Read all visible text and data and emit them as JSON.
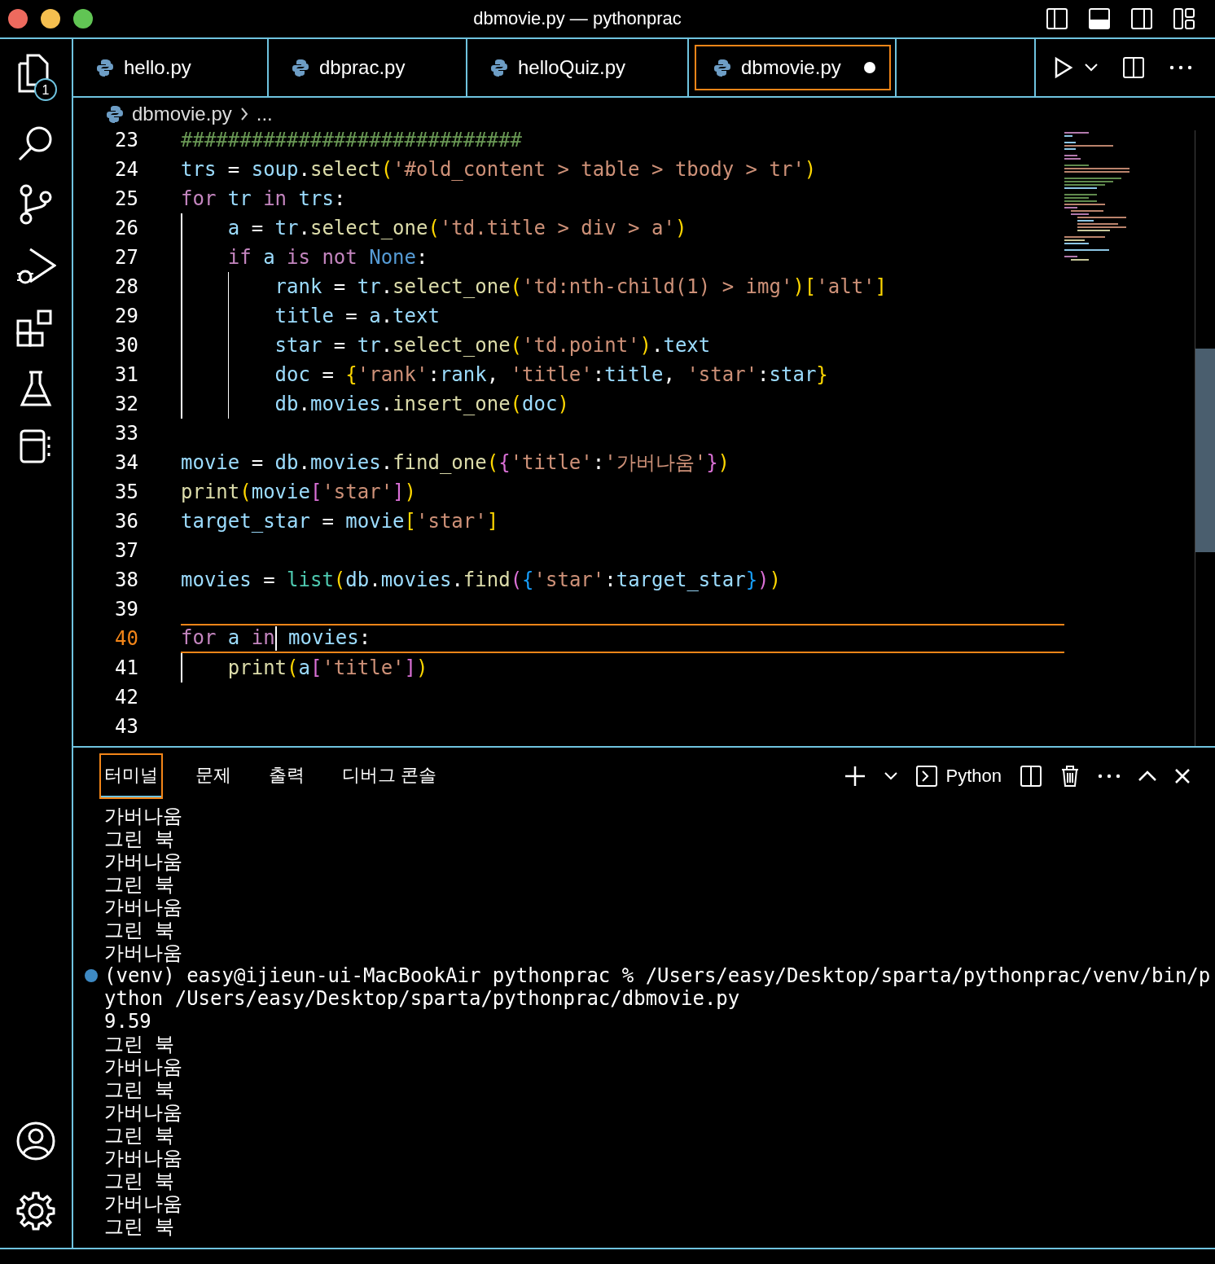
{
  "window": {
    "title": "dbmovie.py — pythonprac"
  },
  "activity_bar": {
    "items": [
      {
        "kind": "files",
        "badge": "1"
      },
      {
        "kind": "search"
      },
      {
        "kind": "source-control"
      },
      {
        "kind": "run-debug"
      },
      {
        "kind": "extensions"
      },
      {
        "kind": "flask"
      },
      {
        "kind": "notebook"
      }
    ],
    "bottom": [
      {
        "kind": "account"
      },
      {
        "kind": "settings"
      }
    ]
  },
  "tabs": [
    {
      "label": "hello.py",
      "selected": false,
      "modified": false
    },
    {
      "label": "dbprac.py",
      "selected": false,
      "modified": false
    },
    {
      "label": "helloQuiz.py",
      "selected": false,
      "modified": false
    },
    {
      "label": "dbmovie.py",
      "selected": true,
      "modified": true
    }
  ],
  "breadcrumb": [
    "dbmovie.py",
    "..."
  ],
  "editor": {
    "lines": [
      {
        "number": "23",
        "current": false,
        "tokens": [
          {
            "kind": "com",
            "text": "#############################"
          }
        ]
      },
      {
        "number": "24",
        "current": false,
        "tokens": [
          {
            "kind": "var",
            "text": "trs"
          },
          {
            "kind": "op",
            "text": " = "
          },
          {
            "kind": "var",
            "text": "soup"
          },
          {
            "kind": "op",
            "text": "."
          },
          {
            "kind": "fn",
            "text": "select"
          },
          {
            "kind": "b1",
            "text": "("
          },
          {
            "kind": "str",
            "text": "'#old_content > table > tbody > tr'"
          },
          {
            "kind": "b1",
            "text": ")"
          }
        ]
      },
      {
        "number": "25",
        "current": false,
        "tokens": [
          {
            "kind": "kw",
            "text": "for "
          },
          {
            "kind": "var",
            "text": "tr "
          },
          {
            "kind": "kw",
            "text": "in "
          },
          {
            "kind": "var",
            "text": "trs"
          },
          {
            "kind": "op",
            "text": ":"
          }
        ]
      },
      {
        "number": "26",
        "current": false,
        "tokens": [
          {
            "kind": "var",
            "text": "    a"
          },
          {
            "kind": "op",
            "text": " = "
          },
          {
            "kind": "var",
            "text": "tr"
          },
          {
            "kind": "op",
            "text": "."
          },
          {
            "kind": "fn",
            "text": "select_one"
          },
          {
            "kind": "b1",
            "text": "("
          },
          {
            "kind": "str",
            "text": "'td.title > div > a'"
          },
          {
            "kind": "b1",
            "text": ")"
          }
        ]
      },
      {
        "number": "27",
        "current": false,
        "tokens": [
          {
            "kind": "kw",
            "text": "    if "
          },
          {
            "kind": "var",
            "text": "a "
          },
          {
            "kind": "kw",
            "text": "is not "
          },
          {
            "kind": "const",
            "text": "None"
          },
          {
            "kind": "op",
            "text": ":"
          }
        ]
      },
      {
        "number": "28",
        "current": false,
        "tokens": [
          {
            "kind": "var",
            "text": "        rank"
          },
          {
            "kind": "op",
            "text": " = "
          },
          {
            "kind": "var",
            "text": "tr"
          },
          {
            "kind": "op",
            "text": "."
          },
          {
            "kind": "fn",
            "text": "select_one"
          },
          {
            "kind": "b1",
            "text": "("
          },
          {
            "kind": "str",
            "text": "'td:nth-child(1) > img'"
          },
          {
            "kind": "b1",
            "text": ")["
          },
          {
            "kind": "str",
            "text": "'alt'"
          },
          {
            "kind": "b1",
            "text": "]"
          }
        ]
      },
      {
        "number": "29",
        "current": false,
        "tokens": [
          {
            "kind": "var",
            "text": "        title"
          },
          {
            "kind": "op",
            "text": " = "
          },
          {
            "kind": "var",
            "text": "a"
          },
          {
            "kind": "op",
            "text": "."
          },
          {
            "kind": "var",
            "text": "text"
          }
        ]
      },
      {
        "number": "30",
        "current": false,
        "tokens": [
          {
            "kind": "var",
            "text": "        star"
          },
          {
            "kind": "op",
            "text": " = "
          },
          {
            "kind": "var",
            "text": "tr"
          },
          {
            "kind": "op",
            "text": "."
          },
          {
            "kind": "fn",
            "text": "select_one"
          },
          {
            "kind": "b1",
            "text": "("
          },
          {
            "kind": "str",
            "text": "'td.point'"
          },
          {
            "kind": "b1",
            "text": ")"
          },
          {
            "kind": "op",
            "text": "."
          },
          {
            "kind": "var",
            "text": "text"
          }
        ]
      },
      {
        "number": "31",
        "current": false,
        "tokens": [
          {
            "kind": "var",
            "text": "        doc"
          },
          {
            "kind": "op",
            "text": " = "
          },
          {
            "kind": "b1",
            "text": "{"
          },
          {
            "kind": "str",
            "text": "'rank'"
          },
          {
            "kind": "op",
            "text": ":"
          },
          {
            "kind": "var",
            "text": "rank"
          },
          {
            "kind": "op",
            "text": ", "
          },
          {
            "kind": "str",
            "text": "'title'"
          },
          {
            "kind": "op",
            "text": ":"
          },
          {
            "kind": "var",
            "text": "title"
          },
          {
            "kind": "op",
            "text": ", "
          },
          {
            "kind": "str",
            "text": "'star'"
          },
          {
            "kind": "op",
            "text": ":"
          },
          {
            "kind": "var",
            "text": "star"
          },
          {
            "kind": "b1",
            "text": "}"
          }
        ]
      },
      {
        "number": "32",
        "current": false,
        "tokens": [
          {
            "kind": "var",
            "text": "        db"
          },
          {
            "kind": "op",
            "text": "."
          },
          {
            "kind": "var",
            "text": "movies"
          },
          {
            "kind": "op",
            "text": "."
          },
          {
            "kind": "fn",
            "text": "insert_one"
          },
          {
            "kind": "b1",
            "text": "("
          },
          {
            "kind": "var",
            "text": "doc"
          },
          {
            "kind": "b1",
            "text": ")"
          }
        ]
      },
      {
        "number": "33",
        "current": false
      },
      {
        "number": "34",
        "current": false,
        "tokens": [
          {
            "kind": "var",
            "text": "movie"
          },
          {
            "kind": "op",
            "text": " = "
          },
          {
            "kind": "var",
            "text": "db"
          },
          {
            "kind": "op",
            "text": "."
          },
          {
            "kind": "var",
            "text": "movies"
          },
          {
            "kind": "op",
            "text": "."
          },
          {
            "kind": "fn",
            "text": "find_one"
          },
          {
            "kind": "b1",
            "text": "("
          },
          {
            "kind": "b2",
            "text": "{"
          },
          {
            "kind": "str",
            "text": "'title'"
          },
          {
            "kind": "op",
            "text": ":"
          },
          {
            "kind": "str",
            "text": "'가버나움'"
          },
          {
            "kind": "b2",
            "text": "}"
          },
          {
            "kind": "b1",
            "text": ")"
          }
        ]
      },
      {
        "number": "35",
        "current": false,
        "tokens": [
          {
            "kind": "fn",
            "text": "print"
          },
          {
            "kind": "b1",
            "text": "("
          },
          {
            "kind": "var",
            "text": "movie"
          },
          {
            "kind": "b2",
            "text": "["
          },
          {
            "kind": "str",
            "text": "'star'"
          },
          {
            "kind": "b2",
            "text": "]"
          },
          {
            "kind": "b1",
            "text": ")"
          }
        ]
      },
      {
        "number": "36",
        "current": false,
        "tokens": [
          {
            "kind": "var",
            "text": "target_star"
          },
          {
            "kind": "op",
            "text": " = "
          },
          {
            "kind": "var",
            "text": "movie"
          },
          {
            "kind": "b1",
            "text": "["
          },
          {
            "kind": "str",
            "text": "'star'"
          },
          {
            "kind": "b1",
            "text": "]"
          }
        ]
      },
      {
        "number": "37",
        "current": false
      },
      {
        "number": "38",
        "current": false,
        "tokens": [
          {
            "kind": "var",
            "text": "movies"
          },
          {
            "kind": "op",
            "text": " = "
          },
          {
            "kind": "cls",
            "text": "list"
          },
          {
            "kind": "b1",
            "text": "("
          },
          {
            "kind": "var",
            "text": "db"
          },
          {
            "kind": "op",
            "text": "."
          },
          {
            "kind": "var",
            "text": "movies"
          },
          {
            "kind": "op",
            "text": "."
          },
          {
            "kind": "fn",
            "text": "find"
          },
          {
            "kind": "b2",
            "text": "("
          },
          {
            "kind": "b3",
            "text": "{"
          },
          {
            "kind": "str",
            "text": "'star'"
          },
          {
            "kind": "op",
            "text": ":"
          },
          {
            "kind": "var",
            "text": "target_star"
          },
          {
            "kind": "b3",
            "text": "}"
          },
          {
            "kind": "b2",
            "text": ")"
          },
          {
            "kind": "b1",
            "text": ")"
          }
        ]
      },
      {
        "number": "39",
        "current": false
      },
      {
        "number": "40",
        "current": true,
        "tokens": [
          {
            "kind": "kw",
            "text": "for "
          },
          {
            "kind": "var",
            "text": "a "
          },
          {
            "kind": "kw",
            "text": "in"
          },
          {
            "kind": "caret"
          },
          {
            "kind": "var",
            "text": " movies"
          },
          {
            "kind": "op",
            "text": ":"
          }
        ]
      },
      {
        "number": "41",
        "current": false,
        "tokens": [
          {
            "kind": "fn",
            "text": "    print"
          },
          {
            "kind": "b1",
            "text": "("
          },
          {
            "kind": "var",
            "text": "a"
          },
          {
            "kind": "b2",
            "text": "["
          },
          {
            "kind": "str",
            "text": "'title'"
          },
          {
            "kind": "b2",
            "text": "]"
          },
          {
            "kind": "b1",
            "text": ")"
          }
        ]
      },
      {
        "number": "42",
        "current": false
      },
      {
        "number": "43",
        "current": false
      }
    ]
  },
  "panel": {
    "tabs": [
      {
        "label": "터미널",
        "selected": true
      },
      {
        "label": "문제",
        "selected": false
      },
      {
        "label": "출력",
        "selected": false
      },
      {
        "label": "디버그 콘솔",
        "selected": false
      }
    ],
    "terminal_profile": "Python",
    "terminal": [
      {
        "kind": "output",
        "text": "가버나움"
      },
      {
        "kind": "output",
        "text": "그린 북"
      },
      {
        "kind": "output",
        "text": "가버나움"
      },
      {
        "kind": "output",
        "text": "그린 북"
      },
      {
        "kind": "output",
        "text": "가버나움"
      },
      {
        "kind": "output",
        "text": "그린 북"
      },
      {
        "kind": "output",
        "text": "가버나움"
      },
      {
        "kind": "prompt",
        "text": "(venv) easy@ijieun-ui-MacBookAir pythonprac % /Users/easy/Desktop/sparta/pythonprac/venv/bin/p"
      },
      {
        "kind": "output",
        "text": "ython /Users/easy/Desktop/sparta/pythonprac/dbmovie.py"
      },
      {
        "kind": "output",
        "text": "9.59"
      },
      {
        "kind": "output",
        "text": "그린 북"
      },
      {
        "kind": "output",
        "text": "가버나움"
      },
      {
        "kind": "output",
        "text": "그린 북"
      },
      {
        "kind": "output",
        "text": "가버나움"
      },
      {
        "kind": "output",
        "text": "그린 북"
      },
      {
        "kind": "output",
        "text": "가버나움"
      },
      {
        "kind": "output",
        "text": "그린 북"
      },
      {
        "kind": "output",
        "text": "가버나움"
      },
      {
        "kind": "output",
        "text": "그린 북"
      }
    ]
  }
}
